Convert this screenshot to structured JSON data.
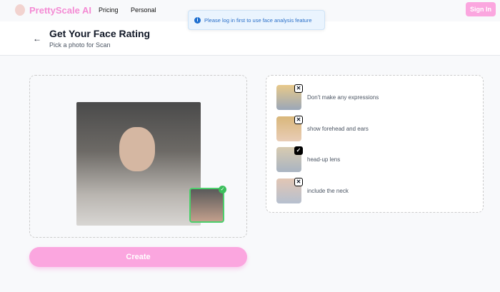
{
  "nav": {
    "brand": "PrettyScale AI",
    "links": [
      "Pricing",
      "Personal"
    ],
    "sign_in": "Sign In"
  },
  "toast": {
    "message": "Please log in first to use face analysis feature"
  },
  "header": {
    "title": "Get Your Face Rating",
    "subtitle": "Pick a photo for Scan"
  },
  "upload": {
    "create_label": "Create"
  },
  "tips": [
    {
      "label": "Don't make any expressions",
      "ok": false
    },
    {
      "label": "show forehead and ears",
      "ok": false
    },
    {
      "label": "head-up lens",
      "ok": true
    },
    {
      "label": "include the neck",
      "ok": false
    }
  ],
  "colors": {
    "brand": "#f48bd4",
    "button": "#fba6df"
  }
}
